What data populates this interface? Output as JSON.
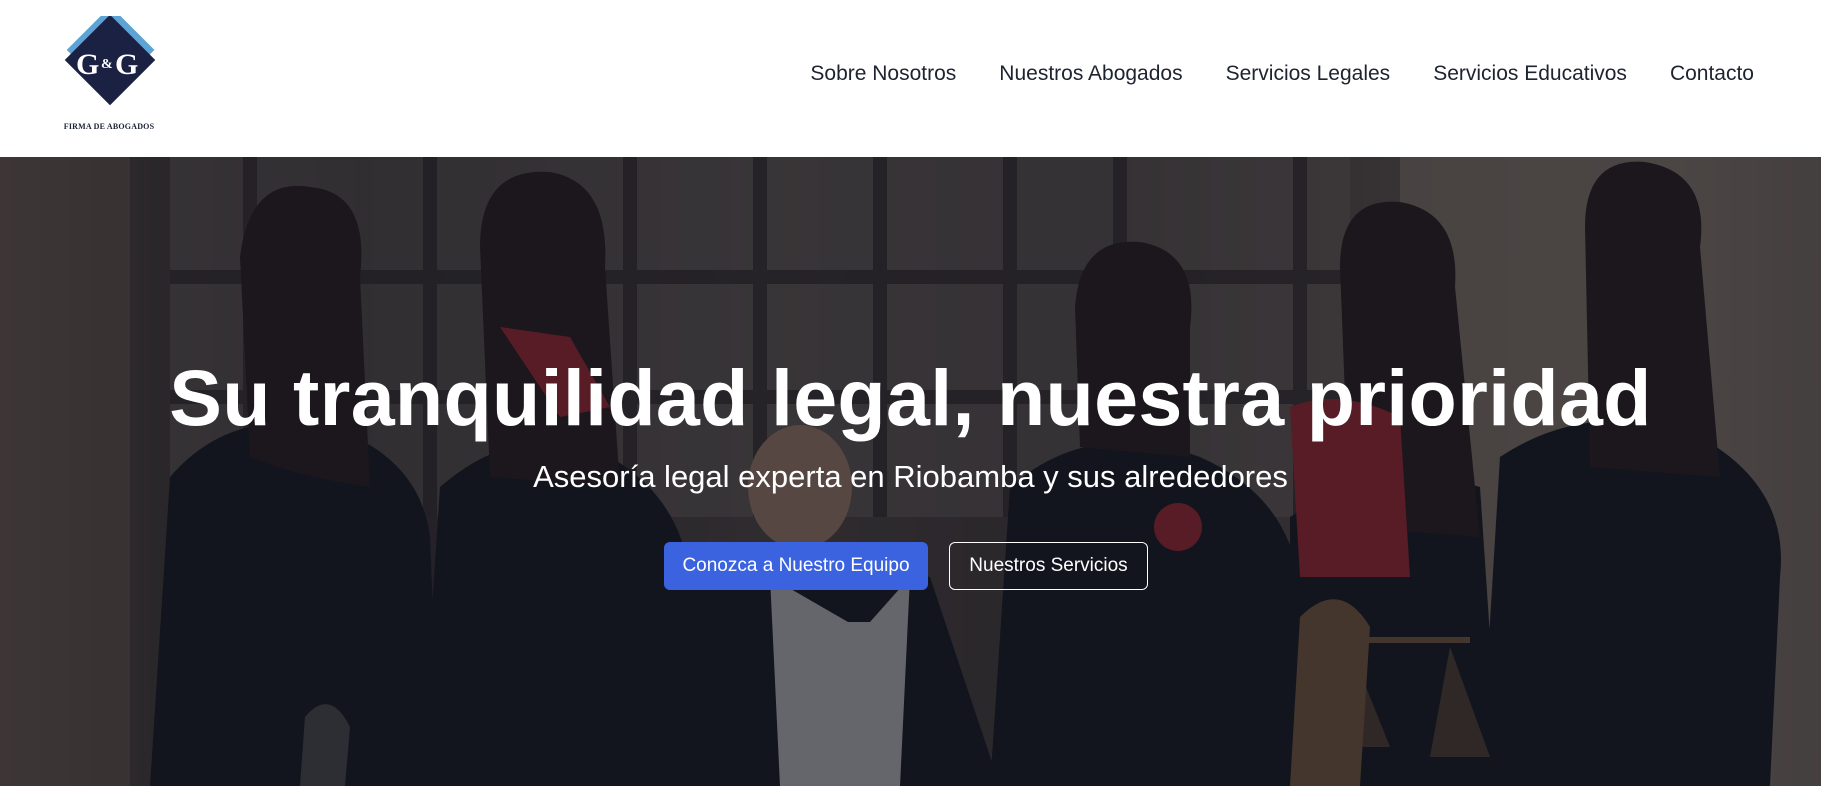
{
  "header": {
    "logo": {
      "monogram": "G&G",
      "caption": "FIRMA DE ABOGADOS",
      "colors": {
        "navy": "#1a2142",
        "light_blue": "#5ea3d6"
      }
    },
    "nav": [
      {
        "label": "Sobre Nosotros"
      },
      {
        "label": "Nuestros Abogados"
      },
      {
        "label": "Servicios Legales"
      },
      {
        "label": "Servicios Educativos"
      },
      {
        "label": "Contacto"
      }
    ]
  },
  "hero": {
    "title": "Su tranquilidad legal, nuestra prioridad",
    "subtitle": "Asesoría legal experta en Riobamba y sus alrededores",
    "primary_button": "Conozca a Nuestro Equipo",
    "secondary_button": "Nuestros Servicios",
    "colors": {
      "primary_button": "#3b63e0",
      "overlay": "rgba(18,22,36,0.58)"
    }
  }
}
